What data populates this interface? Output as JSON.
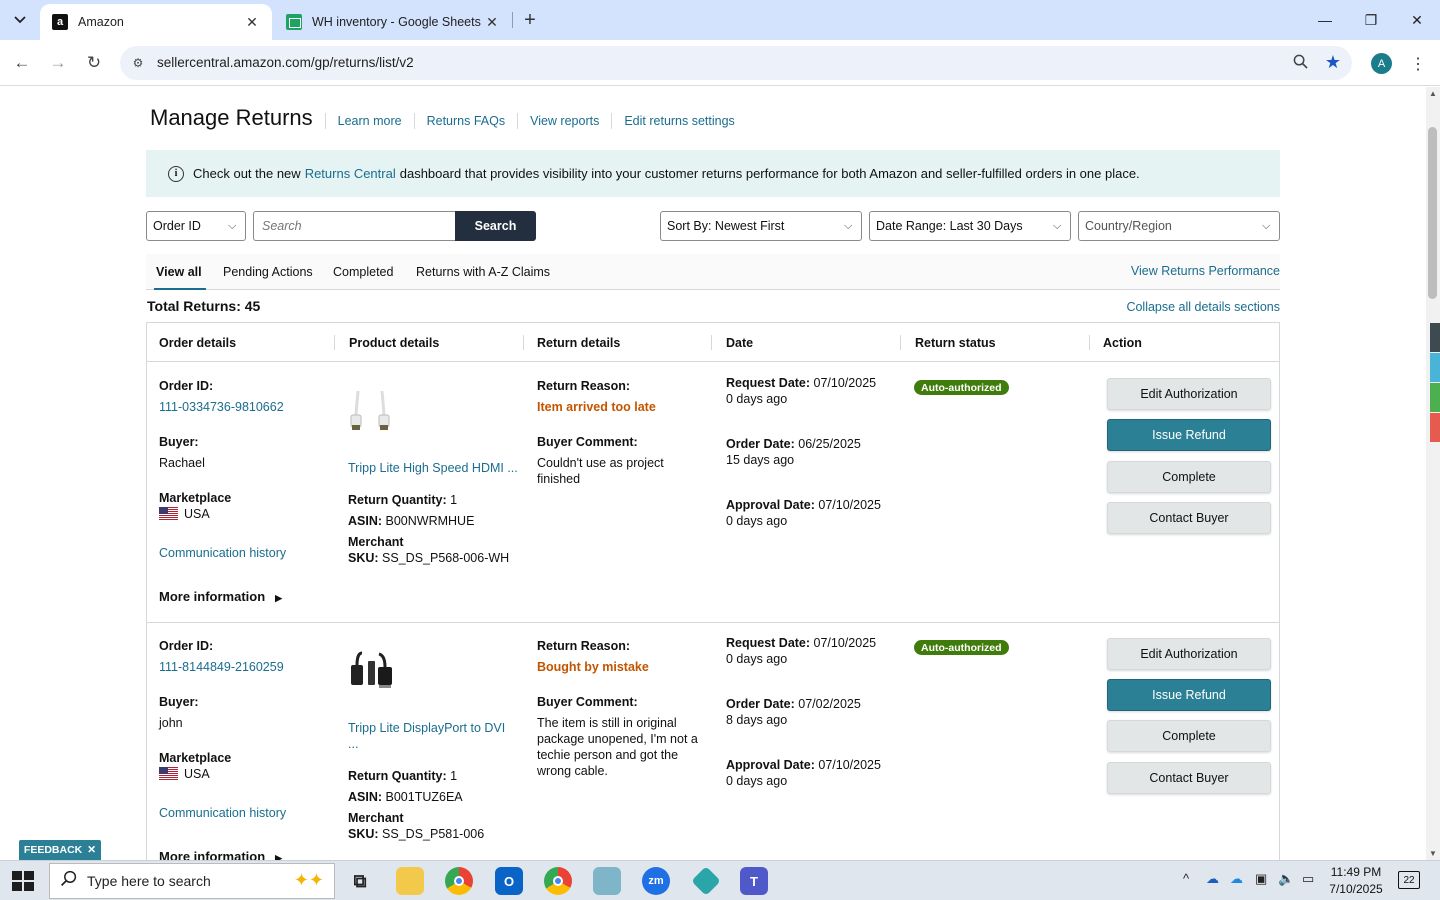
{
  "browser": {
    "tabs": [
      {
        "title": "Amazon",
        "icon": "amazon-favicon"
      },
      {
        "title": "WH inventory - Google Sheets",
        "icon": "google-sheets-favicon"
      }
    ],
    "url": "sellercentral.amazon.com/gp/returns/list/v2",
    "profile_initial": "A"
  },
  "header": {
    "title": "Manage Returns",
    "links": [
      "Learn more",
      "Returns FAQs",
      "View reports",
      "Edit returns settings"
    ]
  },
  "banner": {
    "prefix": "Check out the new",
    "link": "Returns Central",
    "suffix": "dashboard that provides visibility into your customer returns performance for both Amazon and seller-fulfilled orders in one place."
  },
  "filters": {
    "search_type": "Order ID",
    "search_placeholder": "Search",
    "search_button": "Search",
    "sort": "Sort By: Newest First",
    "date_range": "Date Range: Last 30 Days",
    "country": "Country/Region"
  },
  "tabs": [
    "View all",
    "Pending Actions",
    "Completed",
    "Returns with A-Z Claims"
  ],
  "view_performance": "View Returns Performance",
  "total_returns": "Total Returns: 45",
  "collapse_all": "Collapse all details sections",
  "columns": [
    "Order details",
    "Product details",
    "Return details",
    "Date",
    "Return status",
    "Action"
  ],
  "labels": {
    "order_id": "Order ID:",
    "buyer": "Buyer:",
    "marketplace": "Marketplace",
    "communication_history": "Communication history",
    "more_information": "More information",
    "return_quantity": "Return Quantity:",
    "asin": "ASIN:",
    "merchant": "Merchant",
    "sku": "SKU:",
    "return_reason": "Return Reason:",
    "buyer_comment": "Buyer Comment:",
    "request_date": "Request Date:",
    "order_date": "Order Date:",
    "approval_date": "Approval Date:"
  },
  "actions": [
    "Edit Authorization",
    "Issue Refund",
    "Complete",
    "Contact Buyer"
  ],
  "returns": [
    {
      "order_id": "111-0334736-9810662",
      "buyer": "Rachael",
      "marketplace": "USA",
      "product_name": "Tripp Lite High Speed HDMI ...",
      "product_image": "hdmi-cable",
      "return_quantity": "1",
      "asin": "B00NWRMHUE",
      "sku": "SS_DS_P568-006-WH",
      "return_reason": "Item arrived too late",
      "buyer_comment": "Couldn't use as project finished",
      "request_date": "07/10/2025",
      "request_ago": "0 days ago",
      "order_date": "06/25/2025",
      "order_ago": "15 days ago",
      "approval_date": "07/10/2025",
      "approval_ago": "0 days ago",
      "status": "Auto-authorized"
    },
    {
      "order_id": "111-8144849-2160259",
      "buyer": "john",
      "marketplace": "USA",
      "product_name": "Tripp Lite DisplayPort to DVI ...",
      "product_image": "displayport-dvi-cable",
      "return_quantity": "1",
      "asin": "B001TUZ6EA",
      "sku": "SS_DS_P581-006",
      "return_reason": "Bought by mistake",
      "buyer_comment": "The item is still in original package unopened, I'm not a techie person and got the wrong cable.",
      "request_date": "07/10/2025",
      "request_ago": "0 days ago",
      "order_date": "07/02/2025",
      "order_ago": "8 days ago",
      "approval_date": "07/10/2025",
      "approval_ago": "0 days ago",
      "status": "Auto-authorized"
    }
  ],
  "feedback": "FEEDBACK",
  "taskbar": {
    "search_placeholder": "Type here to search",
    "time": "11:49 PM",
    "date": "7/10/2025",
    "notifications": "22"
  },
  "colors": {
    "link": "#1a6d8f",
    "primary_button": "#2b8096",
    "badge": "#3f7c0c",
    "reason": "#c45500",
    "banner_bg": "#e6f3f3"
  }
}
